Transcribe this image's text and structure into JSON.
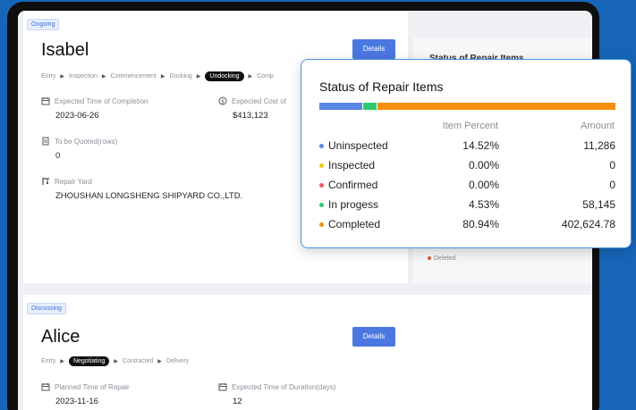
{
  "ongoing": {
    "tag": "Ongoing",
    "name": "Isabel",
    "details_label": "Details",
    "steps": [
      "Entry",
      "Inspection",
      "Commencement",
      "Docking",
      "Undocking",
      "Comp"
    ],
    "active_step_index": 4,
    "fields": {
      "completion_label": "Expected Time of Completion",
      "completion_value": "2023-06-26",
      "cost_label": "Expected Cost of",
      "cost_value": "$413,123",
      "quoted_label": "To be Quoted(rows)",
      "quoted_value": "0",
      "yard_label": "Repair Yard",
      "yard_value": "ZHOUSHAN LONGSHENG SHIPYARD CO.,LTD."
    },
    "side_panel_title": "Status of Repair Items",
    "side_panel_deleted": "Deleted"
  },
  "discussing": {
    "tag": "Discussing",
    "name": "Alice",
    "details_label": "Details",
    "steps": [
      "Entry",
      "Negotiating",
      "Contracted",
      "Delivery"
    ],
    "active_step_index": 1,
    "fields": {
      "repair_label": "Planned Time of Repair",
      "repair_value": "2023-11-16",
      "duration_label": "Expected Time of Duration(days)",
      "duration_value": "12"
    }
  },
  "popup": {
    "title": "Status of Repair Items",
    "col_percent": "Item Percent",
    "col_amount": "Amount",
    "rows": [
      {
        "label": "Uninspected",
        "percent": "14.52%",
        "amount": "11,286",
        "color": "#5b86e5"
      },
      {
        "label": "Inspected",
        "percent": "0.00%",
        "amount": "0",
        "color": "#f5c518"
      },
      {
        "label": "Confirmed",
        "percent": "0.00%",
        "amount": "0",
        "color": "#ef5b6b"
      },
      {
        "label": "In progess",
        "percent": "4.53%",
        "amount": "58,145",
        "color": "#2ecc71"
      },
      {
        "label": "Completed",
        "percent": "80.94%",
        "amount": "402,624.78",
        "color": "#f5900f"
      }
    ],
    "bar_segments": [
      {
        "fraction": 0.1452,
        "color": "#5b86e5"
      },
      {
        "fraction": 0.0453,
        "color": "#2ecc71"
      },
      {
        "fraction": 0.8094,
        "color": "#f5900f"
      }
    ]
  }
}
